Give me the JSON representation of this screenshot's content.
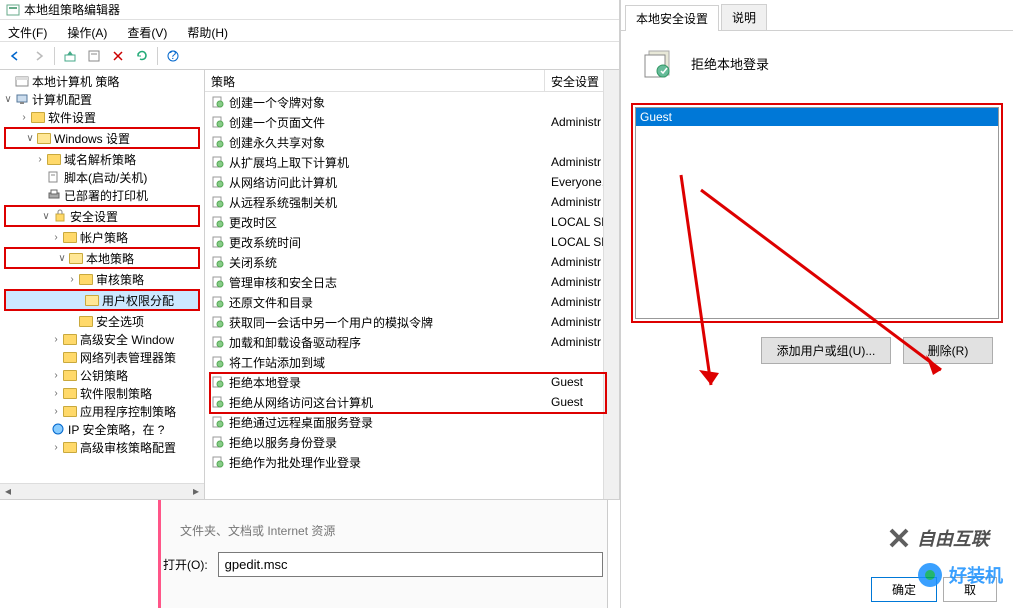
{
  "window_title": "本地组策略编辑器",
  "menus": {
    "file": "文件(F)",
    "action": "操作(A)",
    "view": "查看(V)",
    "help": "帮助(H)"
  },
  "tree": {
    "root": "本地计算机 策略",
    "computer_config": "计算机配置",
    "software_settings": "软件设置",
    "windows_settings": "Windows 设置",
    "name_res": "域名解析策略",
    "scripts": "脚本(启动/关机)",
    "printers": "已部署的打印机",
    "security_settings": "安全设置",
    "account_policies": "帐户策略",
    "local_policies": "本地策略",
    "audit": "审核策略",
    "user_rights": "用户权限分配",
    "security_options": "安全选项",
    "adv_firewall": "高级安全 Window",
    "network_list": "网络列表管理器策",
    "public_key": "公钥策略",
    "software_restrict": "软件限制策略",
    "app_control": "应用程序控制策略",
    "ip_sec": "IP 安全策略，在 ?",
    "adv_audit": "高级审核策略配置"
  },
  "list_headers": {
    "policy": "策略",
    "security": "安全设置"
  },
  "policies": [
    {
      "name": "创建一个令牌对象",
      "setting": ""
    },
    {
      "name": "创建一个页面文件",
      "setting": "Administr"
    },
    {
      "name": "创建永久共享对象",
      "setting": ""
    },
    {
      "name": "从扩展坞上取下计算机",
      "setting": "Administr"
    },
    {
      "name": "从网络访问此计算机",
      "setting": "Everyone,"
    },
    {
      "name": "从远程系统强制关机",
      "setting": "Administr"
    },
    {
      "name": "更改时区",
      "setting": "LOCAL SE"
    },
    {
      "name": "更改系统时间",
      "setting": "LOCAL SE"
    },
    {
      "name": "关闭系统",
      "setting": "Administr"
    },
    {
      "name": "管理审核和安全日志",
      "setting": "Administr"
    },
    {
      "name": "还原文件和目录",
      "setting": "Administr"
    },
    {
      "name": "获取同一会话中另一个用户的模拟令牌",
      "setting": "Administr"
    },
    {
      "name": "加载和卸载设备驱动程序",
      "setting": "Administr"
    },
    {
      "name": "将工作站添加到域",
      "setting": ""
    },
    {
      "name": "拒绝本地登录",
      "setting": "Guest"
    },
    {
      "name": "拒绝从网络访问这台计算机",
      "setting": "Guest"
    },
    {
      "name": "拒绝通过远程桌面服务登录",
      "setting": ""
    },
    {
      "name": "拒绝以服务身份登录",
      "setting": ""
    },
    {
      "name": "拒绝作为批处理作业登录",
      "setting": ""
    }
  ],
  "right": {
    "tab_local": "本地安全设置",
    "tab_explain": "说明",
    "title": "拒绝本地登录",
    "selected_user": "Guest",
    "add_btn": "添加用户或组(U)...",
    "remove_btn": "删除(R)",
    "ok": "确定",
    "cancel": "取"
  },
  "run": {
    "label": "打开(O):",
    "value": "gpedit.msc",
    "hint": "文件夹、文档或 Internet 资源"
  },
  "watermark": {
    "a": "自由互联",
    "b": "好装机"
  }
}
